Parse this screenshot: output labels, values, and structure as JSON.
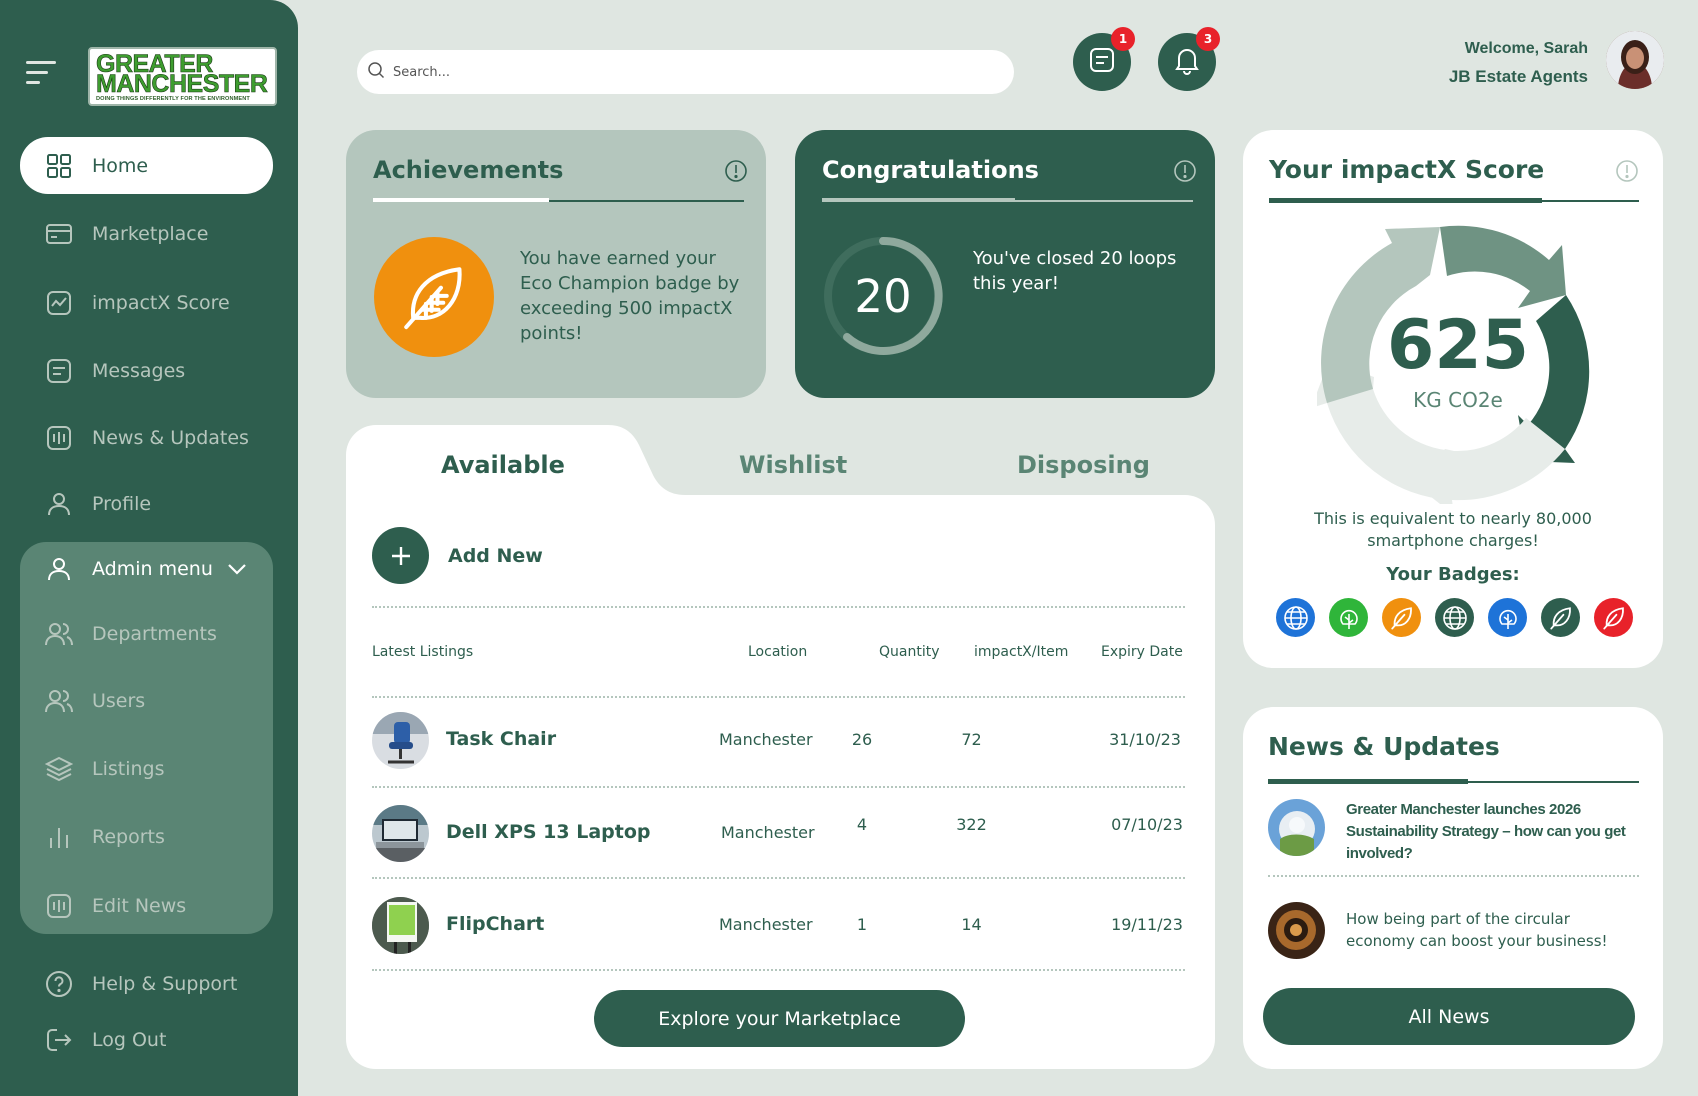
{
  "brand": {
    "logo_line1": "GREATER",
    "logo_line2": "MANCHESTER",
    "logo_tagline": "DOING THINGS DIFFERENTLY FOR THE ENVIRONMENT"
  },
  "sidebar": {
    "items": [
      {
        "label": "Home",
        "icon": "grid-icon",
        "active": true
      },
      {
        "label": "Marketplace",
        "icon": "card-icon"
      },
      {
        "label": "impactX Score",
        "icon": "chart-line-icon"
      },
      {
        "label": "Messages",
        "icon": "message-icon"
      },
      {
        "label": "News & Updates",
        "icon": "news-icon"
      },
      {
        "label": "Profile",
        "icon": "user-icon"
      }
    ],
    "admin": {
      "label": "Admin menu",
      "items": [
        {
          "label": "Departments",
          "icon": "users-icon"
        },
        {
          "label": "Users",
          "icon": "users-icon"
        },
        {
          "label": "Listings",
          "icon": "layers-icon"
        },
        {
          "label": "Reports",
          "icon": "bar-chart-icon"
        },
        {
          "label": "Edit News",
          "icon": "news-icon"
        }
      ]
    },
    "footer": [
      {
        "label": "Help & Support",
        "icon": "help-icon"
      },
      {
        "label": "Log Out",
        "icon": "logout-icon"
      }
    ]
  },
  "header": {
    "search_placeholder": "Search...",
    "messages_count": "1",
    "notifications_count": "3",
    "welcome": "Welcome, Sarah",
    "company": "JB Estate Agents"
  },
  "achievements": {
    "title": "Achievements",
    "text": "You have earned your Eco Champion badge by exceeding 500 impactX points!"
  },
  "congratulations": {
    "title": "Congratulations",
    "number": "20",
    "text": "You've closed 20 loops this year!"
  },
  "listings": {
    "tabs": [
      "Available",
      "Wishlist",
      "Disposing"
    ],
    "add_new": "Add New",
    "columns": [
      "Latest Listings",
      "Location",
      "Quantity",
      "impactX/Item",
      "Expiry Date"
    ],
    "rows": [
      {
        "name": "Task Chair",
        "location": "Manchester",
        "quantity": "26",
        "impactx": "72",
        "expiry": "31/10/23"
      },
      {
        "name": "Dell XPS 13 Laptop",
        "location": "Manchester",
        "quantity": "4",
        "impactx": "322",
        "expiry": "07/10/23"
      },
      {
        "name": "FlipChart",
        "location": "Manchester",
        "quantity": "1",
        "impactx": "14",
        "expiry": "19/11/23"
      }
    ],
    "explore_button": "Explore your Marketplace"
  },
  "score": {
    "title": "Your impactX Score",
    "value": "625",
    "unit": "KG CO2e",
    "equivalent": "This is equivalent to nearly 80,000 smartphone charges!",
    "badges_label": "Your Badges:",
    "badges": [
      {
        "icon": "globe-icon",
        "color": "#1e73d8"
      },
      {
        "icon": "tree-icon",
        "color": "#2fb53a"
      },
      {
        "icon": "leaf-icon",
        "color": "#f0900e"
      },
      {
        "icon": "globe-icon",
        "color": "#2e5e4e"
      },
      {
        "icon": "tree-icon",
        "color": "#1e73d8"
      },
      {
        "icon": "leaf-icon",
        "color": "#2e5e4e"
      },
      {
        "icon": "leaf-icon",
        "color": "#e8222a"
      }
    ]
  },
  "news": {
    "title": "News & Updates",
    "items": [
      {
        "text": "Greater Manchester launches 2026 Sustainability Strategy – how can you get involved?"
      },
      {
        "text": "How being part of the circular economy can boost your business!"
      }
    ],
    "all_button": "All News"
  },
  "colors": {
    "primary": "#2e5e4e",
    "sage": "#b4c6bd",
    "background": "#dfe6e1",
    "accent_orange": "#f0900e",
    "alert_red": "#e8222a"
  }
}
